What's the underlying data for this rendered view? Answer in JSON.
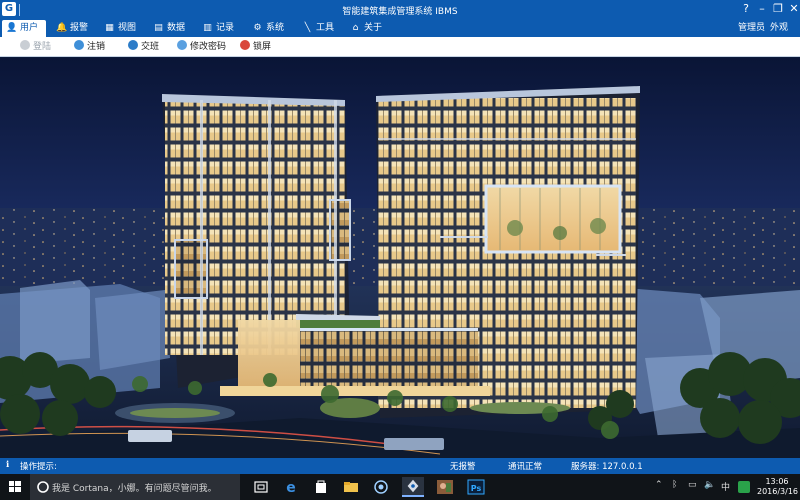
{
  "window": {
    "title": "智能建筑集成管理系统  IBMS",
    "icon_label": "G"
  },
  "menu": {
    "items": [
      {
        "label": "用户",
        "icon": "user-icon",
        "active": true
      },
      {
        "label": "报警",
        "icon": "alarm-bell-icon"
      },
      {
        "label": "视图",
        "icon": "view-icon"
      },
      {
        "label": "数据",
        "icon": "data-icon"
      },
      {
        "label": "记录",
        "icon": "record-icon"
      },
      {
        "label": "系统",
        "icon": "gear-icon"
      },
      {
        "label": "工具",
        "icon": "wrench-icon"
      },
      {
        "label": "关于",
        "icon": "home-icon"
      }
    ],
    "user_label": "管理员",
    "appearance_label": "外观"
  },
  "toolbar": {
    "items": [
      {
        "label": "登陆",
        "icon": "login-icon",
        "enabled": false
      },
      {
        "label": "注销",
        "icon": "logout-icon",
        "enabled": true
      },
      {
        "label": "交班",
        "icon": "handover-icon",
        "enabled": true
      },
      {
        "label": "修改密码",
        "icon": "change-password-icon",
        "enabled": true
      },
      {
        "label": "锁屏",
        "icon": "lock-screen-icon",
        "enabled": true
      }
    ]
  },
  "status": {
    "hint_label": "操作提示:",
    "alarm_status": "无报警",
    "comm_status": "通讯正常",
    "server_label": "服务器: 127.0.0.1"
  },
  "taskbar": {
    "search_placeholder": "我是 Cortana，小娜。有问题尽管问我。",
    "apps": [
      "task-view-icon",
      "edge-icon",
      "store-icon",
      "file-explorer-icon",
      "network-app-icon",
      "app-icon",
      "photo-app-icon",
      "photoshop-icon"
    ],
    "ps_label": "Ps",
    "time": "13:06",
    "date": "2016/3/16"
  },
  "colors": {
    "brand_blue": "#0d5bb0",
    "taskbar": "#101418"
  }
}
